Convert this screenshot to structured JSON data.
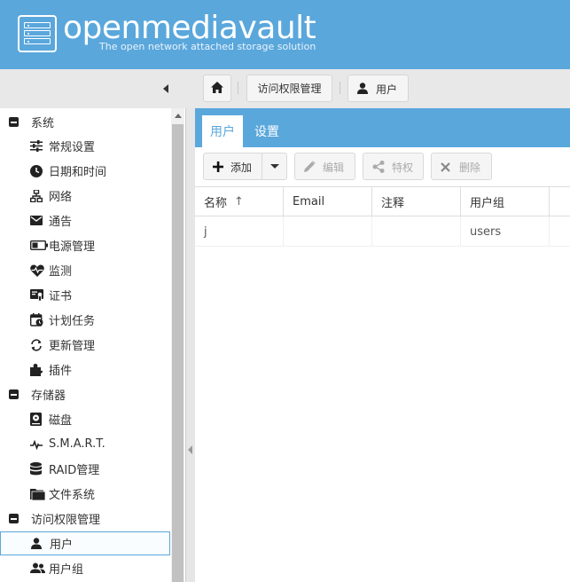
{
  "header": {
    "brand": "openmediavault",
    "tagline": "The open network attached storage solution",
    "color": "#5aa7dc"
  },
  "breadcrumb": {
    "home_icon": "home-icon",
    "items": [
      "访问权限管理",
      "用户"
    ],
    "user_icon": "user-icon"
  },
  "sidebar": {
    "items": [
      {
        "label": "系统",
        "icon": "minus-box-icon",
        "level": "group"
      },
      {
        "label": "常规设置",
        "icon": "sliders-icon",
        "level": "child"
      },
      {
        "label": "日期和时间",
        "icon": "clock-icon",
        "level": "child"
      },
      {
        "label": "网络",
        "icon": "network-icon",
        "level": "child"
      },
      {
        "label": "通告",
        "icon": "envelope-icon",
        "level": "child"
      },
      {
        "label": "电源管理",
        "icon": "battery-icon",
        "level": "child"
      },
      {
        "label": "监测",
        "icon": "heartbeat-icon",
        "level": "child"
      },
      {
        "label": "证书",
        "icon": "certificate-icon",
        "level": "child"
      },
      {
        "label": "计划任务",
        "icon": "calendar-clock-icon",
        "level": "child"
      },
      {
        "label": "更新管理",
        "icon": "refresh-icon",
        "level": "child"
      },
      {
        "label": "插件",
        "icon": "puzzle-icon",
        "level": "child"
      },
      {
        "label": "存储器",
        "icon": "minus-box-icon",
        "level": "group"
      },
      {
        "label": "磁盘",
        "icon": "harddisk-icon",
        "level": "child"
      },
      {
        "label": "S.M.A.R.T.",
        "icon": "pulse-icon",
        "level": "child"
      },
      {
        "label": "RAID管理",
        "icon": "database-icon",
        "level": "child"
      },
      {
        "label": "文件系统",
        "icon": "folder-icon",
        "level": "child"
      },
      {
        "label": "访问权限管理",
        "icon": "minus-box-icon",
        "level": "group"
      },
      {
        "label": "用户",
        "icon": "user-icon",
        "level": "child",
        "selected": true
      },
      {
        "label": "用户组",
        "icon": "users-icon",
        "level": "child"
      }
    ]
  },
  "tabs": [
    {
      "label": "用户",
      "active": true
    },
    {
      "label": "设置",
      "active": false
    }
  ],
  "actions": {
    "add": "添加",
    "edit": "编辑",
    "privileges": "特权",
    "delete": "删除"
  },
  "grid": {
    "columns": [
      "名称",
      "Email",
      "注释",
      "用户组"
    ],
    "sort_indicator": "↑",
    "rows": [
      {
        "name": "j",
        "email": "",
        "comment": "",
        "groups": "users"
      }
    ]
  }
}
